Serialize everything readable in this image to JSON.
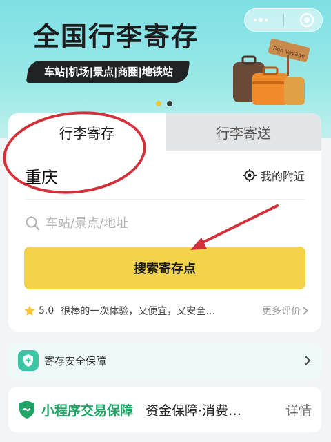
{
  "banner": {
    "title": "全国行李寄存",
    "tagline": "车站|机场|景点|商圈|地铁站",
    "sign_text": "Bon Voyage",
    "carousel_dots": 2,
    "active_dot": 0
  },
  "tabs": [
    {
      "label": "行李寄存",
      "active": true
    },
    {
      "label": "行李寄送",
      "active": false
    }
  ],
  "location": {
    "city": "重庆",
    "nearby_label": "我的附近"
  },
  "search": {
    "placeholder": "车站/景点/地址",
    "button_label": "搜索寄存点"
  },
  "review": {
    "score": "5.0",
    "text": "很棒的一次体验，又便宜，又安全…",
    "more_label": "更多评价"
  },
  "safety": {
    "label": "寄存安全保障"
  },
  "guarantee": {
    "label": "小程序交易保障",
    "description": "资金保障·消费…",
    "details_label": "详情"
  },
  "colors": {
    "banner_bg": "#8fe5e6",
    "primary_button": "#f3d34a",
    "accent_green": "#21a567",
    "annotation_red": "#d3303a",
    "star": "#f5c231"
  },
  "icons": {
    "nearby": "target-icon",
    "search": "search-icon",
    "star": "star-icon",
    "safety": "shield-plus-icon",
    "guarantee": "shield-check-icon"
  }
}
